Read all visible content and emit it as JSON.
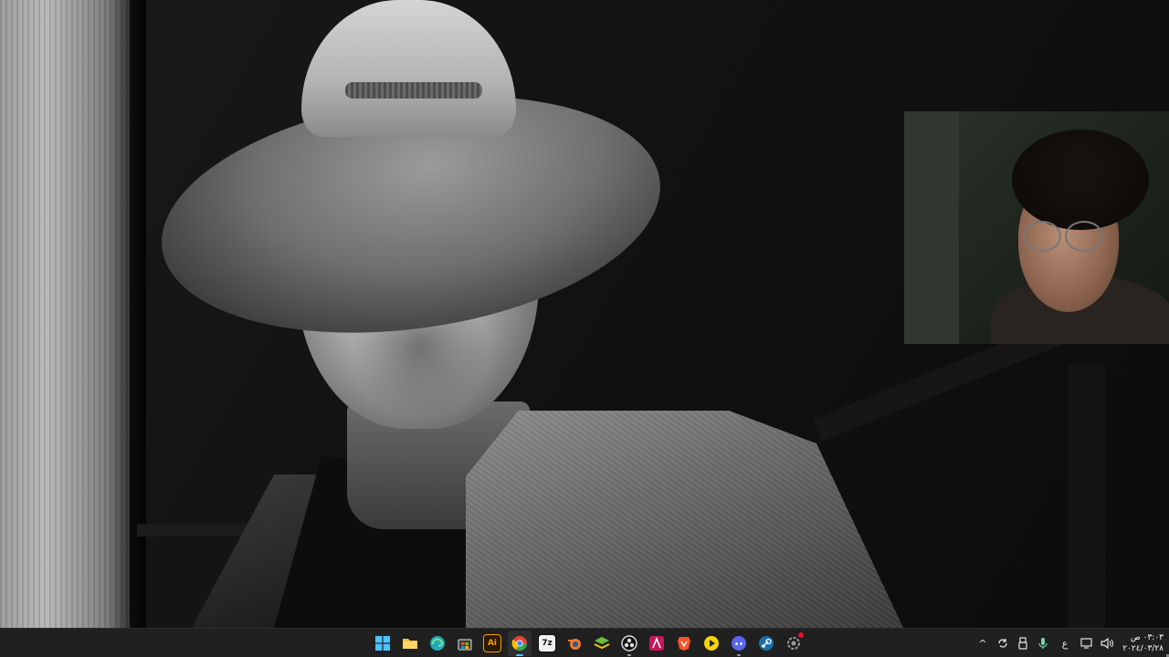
{
  "desktop": {
    "wallpaper_icon": "monochrome-portrait-photo"
  },
  "webcam": {
    "icon": "webcam-feed"
  },
  "taskbar": {
    "apps": [
      {
        "name": "start",
        "icon": "windows-logo-icon",
        "glyph": "",
        "color": "#4cc2ff",
        "state": ""
      },
      {
        "name": "file-explorer",
        "icon": "folder-icon",
        "glyph": "",
        "color": "#f8c23a",
        "state": ""
      },
      {
        "name": "edge",
        "icon": "edge-icon",
        "glyph": "",
        "color": "#1fa9b8",
        "state": ""
      },
      {
        "name": "microsoft-store",
        "icon": "store-icon",
        "glyph": "",
        "color": "#e6e6e6",
        "state": ""
      },
      {
        "name": "illustrator",
        "icon": "illustrator-icon",
        "glyph": "Ai",
        "color": "#ff9a00",
        "state": ""
      },
      {
        "name": "chrome",
        "icon": "chrome-icon",
        "glyph": "",
        "color": "#e94235",
        "state": "active"
      },
      {
        "name": "7zip",
        "icon": "7zip-icon",
        "glyph": "7z",
        "color": "#111111",
        "state": ""
      },
      {
        "name": "blender",
        "icon": "blender-icon",
        "glyph": "",
        "color": "#f5792a",
        "state": ""
      },
      {
        "name": "layers-app",
        "icon": "layers-icon",
        "glyph": "",
        "color": "#6bbf3c",
        "state": ""
      },
      {
        "name": "obs",
        "icon": "obs-icon",
        "glyph": "",
        "color": "#dcdcdc",
        "state": "running"
      },
      {
        "name": "affinity",
        "icon": "affinity-icon",
        "glyph": "",
        "color": "#c2185b",
        "state": ""
      },
      {
        "name": "brave",
        "icon": "brave-icon",
        "glyph": "",
        "color": "#fb542b",
        "state": ""
      },
      {
        "name": "media-player",
        "icon": "play-circle-icon",
        "glyph": "",
        "color": "#f5d50a",
        "state": ""
      },
      {
        "name": "discord",
        "icon": "discord-icon",
        "glyph": "",
        "color": "#5865f2",
        "state": "running"
      },
      {
        "name": "steam",
        "icon": "steam-icon",
        "glyph": "",
        "color": "#1b6fa8",
        "state": ""
      },
      {
        "name": "system-app",
        "icon": "settings-gear-icon",
        "glyph": "",
        "color": "#9a9a9a",
        "state": "badge"
      }
    ],
    "tray": {
      "chevron": "^",
      "input_language": "ع",
      "clock": {
        "time": "٠٣:٠٣ ص",
        "date": "٢٠٢٤/٠٣/٢٨"
      }
    }
  }
}
